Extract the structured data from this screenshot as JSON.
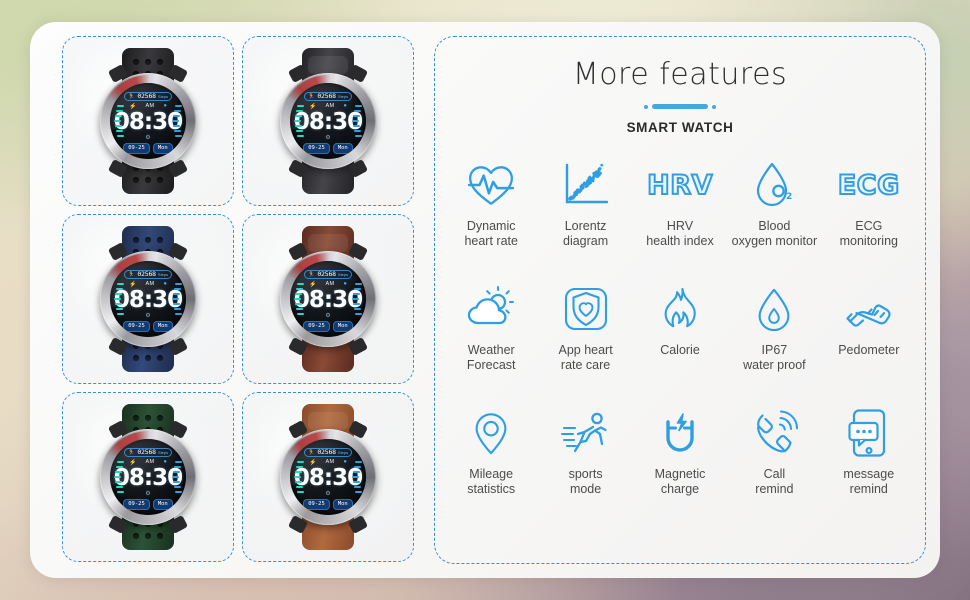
{
  "theme": {
    "accent_blue": "#2f9ee2",
    "divider_blue": "#46a6e0",
    "dashed_border": "#3a8fd4",
    "label_text": "#4c4c4c",
    "title_text": "#2e2e2e",
    "card_background": "#fbfbfa"
  },
  "watch_face": {
    "steps_value": "02568",
    "steps_unit": "Steps",
    "meridiem": "AM",
    "time": "08:30",
    "date_badge": "09-25",
    "day_badge": "Mon",
    "runner_icon": "runner-icon",
    "bolt_icon": "bolt-icon",
    "bluetooth_icon": "bluetooth-icon",
    "gear_icon": "gear-icon"
  },
  "watches": [
    {
      "name": "black-perforated-watch",
      "band_color": "#1b1b1d",
      "band_highlight": "#3a3a3e",
      "band_style": "perforated"
    },
    {
      "name": "black-smooth-watch",
      "band_color": "#232326",
      "band_highlight": "#45454a",
      "band_style": "smooth"
    },
    {
      "name": "navy-perforated-watch",
      "band_color": "#1d2c4c",
      "band_highlight": "#33497a",
      "band_style": "perforated"
    },
    {
      "name": "brown-leather-watch",
      "band_color": "#5a2a20",
      "band_highlight": "#8a4a35",
      "band_style": "smooth"
    },
    {
      "name": "green-perforated-watch",
      "band_color": "#18301f",
      "band_highlight": "#2d5236",
      "band_style": "perforated"
    },
    {
      "name": "tan-leather-watch",
      "band_color": "#8a4a2a",
      "band_highlight": "#b06a40",
      "band_style": "smooth"
    }
  ],
  "panel": {
    "title": "More features",
    "subtitle": "SMART WATCH"
  },
  "features": [
    {
      "icon": "heart-pulse-icon",
      "label": "Dynamic\nheart rate"
    },
    {
      "icon": "scatter-plot-icon",
      "label": "Lorentz\ndiagram"
    },
    {
      "icon": "hrv-wordmark-icon",
      "label": "HRV\nhealth index",
      "wordmark": "HRV"
    },
    {
      "icon": "blood-oxygen-drop-icon",
      "label": "Blood\noxygen monitor"
    },
    {
      "icon": "ecg-wordmark-icon",
      "label": "ECG\nmonitoring",
      "wordmark": "ECG"
    },
    {
      "icon": "sun-cloud-icon",
      "label": "Weather\nForecast"
    },
    {
      "icon": "shield-heart-app-icon",
      "label": "App heart\nrate care"
    },
    {
      "icon": "flame-icon",
      "label": "Calorie"
    },
    {
      "icon": "water-drop-icon",
      "label": "IP67\nwater proof"
    },
    {
      "icon": "sneaker-icon",
      "label": "Pedometer"
    },
    {
      "icon": "map-pin-icon",
      "label": "Mileage\nstatistics"
    },
    {
      "icon": "running-person-icon",
      "label": "sports\nmode"
    },
    {
      "icon": "magnet-bolt-icon",
      "label": "Magnetic\ncharge"
    },
    {
      "icon": "ringing-phone-icon",
      "label": "Call\nremind"
    },
    {
      "icon": "message-phone-icon",
      "label": "message\nremind"
    }
  ]
}
